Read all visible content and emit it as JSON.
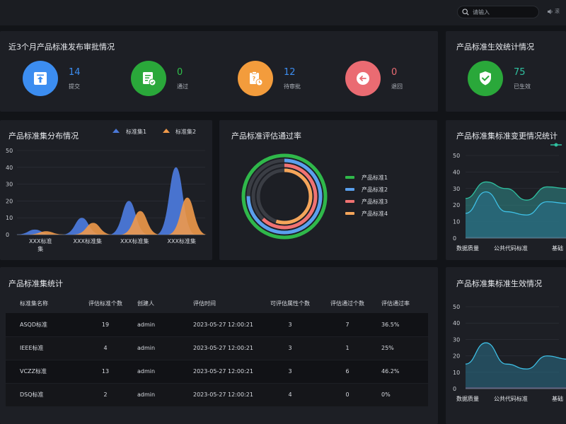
{
  "header": {
    "search_placeholder": "请输入",
    "speaker_text": "滚"
  },
  "approval": {
    "title": "近3个月产品标准发布审批情况",
    "stats": [
      {
        "value": "14",
        "label": "提交",
        "color": "#3c8df0",
        "value_color": "#3c8df0",
        "icon": "upload-icon"
      },
      {
        "value": "0",
        "label": "通过",
        "color": "#2aa83a",
        "value_color": "#2fc14b",
        "icon": "approved-doc-icon"
      },
      {
        "value": "12",
        "label": "待审批",
        "color": "#f39c3c",
        "value_color": "#3c8df0",
        "icon": "pending-clock-icon"
      },
      {
        "value": "0",
        "label": "退回",
        "color": "#ea6b72",
        "value_color": "#ea6b72",
        "icon": "return-arrow-icon"
      }
    ]
  },
  "effective": {
    "title": "产品标准生效统计情况",
    "value": "75",
    "label": "已生效",
    "color": "#2aa83a",
    "value_color": "#2fc1a0",
    "icon": "shield-check-icon"
  },
  "distribution": {
    "title": "产品标准集分布情况",
    "legend": [
      "标准集1",
      "标准集2"
    ],
    "series_colors": [
      "#4b78d8",
      "#f0994a"
    ],
    "chart_data": {
      "type": "area",
      "categories": [
        "XXX标准集",
        "XXX标准集",
        "XXX标准集",
        "XXX标准集"
      ],
      "series": [
        {
          "name": "标准集1",
          "values": [
            3,
            10,
            20,
            40
          ]
        },
        {
          "name": "标准集2",
          "values": [
            2,
            7,
            14,
            22
          ]
        }
      ],
      "yticks": [
        "50",
        "40",
        "30",
        "20",
        "10",
        "0"
      ],
      "ylim": [
        0,
        50
      ]
    }
  },
  "passrate": {
    "title": "产品标准评估通过率",
    "chart_data": {
      "type": "pie",
      "series": [
        {
          "name": "产品标准1",
          "value": 1.0,
          "color": "#2fb84a"
        },
        {
          "name": "产品标准2",
          "value": 0.75,
          "color": "#5aa0ee"
        },
        {
          "name": "产品标准3",
          "value": 0.62,
          "color": "#f07272"
        },
        {
          "name": "产品标准4",
          "value": 0.55,
          "color": "#f5a55a"
        }
      ]
    }
  },
  "changes": {
    "title": "产品标准集标准变更情况统计",
    "chart_data": {
      "type": "area",
      "categories": [
        "数据质量",
        "公共代码标准",
        "基础"
      ],
      "series": [
        {
          "values": [
            24,
            34,
            30,
            23,
            31,
            30
          ]
        },
        {
          "values": [
            15,
            28,
            16,
            14,
            22,
            21
          ]
        }
      ],
      "yticks": [
        "50",
        "40",
        "30",
        "20",
        "10",
        "0"
      ],
      "ylim": [
        0,
        50
      ]
    }
  },
  "table": {
    "title": "产品标准集统计",
    "columns": [
      "标准集名称",
      "评估标准个数",
      "创建人",
      "评估时间",
      "可评估属性个数",
      "评估通过个数",
      "评估通过率"
    ],
    "rows": [
      [
        "ASQD标准",
        "19",
        "admin",
        "2023-05-27 12:00:21",
        "3",
        "7",
        "36.5%"
      ],
      [
        "IEEE标准",
        "4",
        "admin",
        "2023-05-27 12:00:21",
        "3",
        "1",
        "25%"
      ],
      [
        "VCZZ标准",
        "13",
        "admin",
        "2023-05-27 12:00:21",
        "3",
        "6",
        "46.2%"
      ],
      [
        "DSQ标准",
        "2",
        "admin",
        "2023-05-27 12:00:21",
        "4",
        "0",
        "0%"
      ]
    ]
  },
  "effect_status": {
    "title": "产品标准集标准生效情况",
    "chart_data": {
      "type": "area",
      "categories": [
        "数据质量",
        "公共代码标准",
        "基础"
      ],
      "series": [
        {
          "values": [
            15,
            28,
            15,
            12,
            20,
            18
          ]
        }
      ],
      "yticks": [
        "50",
        "40",
        "30",
        "20",
        "10",
        "0"
      ],
      "ylim": [
        0,
        50
      ]
    }
  }
}
